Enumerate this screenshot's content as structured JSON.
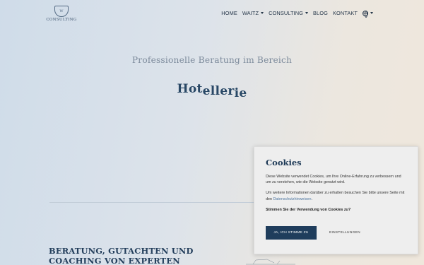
{
  "logo": {
    "crest_text": "W",
    "small_text": "WAITZ",
    "brand_text": "CONSULTING"
  },
  "nav": {
    "items": [
      {
        "label": "HOME"
      },
      {
        "label": "WAITZ"
      },
      {
        "label": "CONSULTING"
      },
      {
        "label": "BLOG"
      },
      {
        "label": "KONTAKT"
      }
    ]
  },
  "hero": {
    "subtitle": "Professionelle Beratung im Bereich",
    "word_parts": [
      "Hot",
      "eller",
      "ie"
    ]
  },
  "section": {
    "title": "Beratung, Gutachten und Coaching von Experten"
  },
  "cookie": {
    "title": "Cookies",
    "text1": "Diese Website verwendet Cookies, um Ihre Online-Erfahrung zu verbessern und um zu verstehen, wie die Website genutzt wird.",
    "text2_prefix": "Um weitere Informationen darüber zu erhalten besuchen Sie bitte unsere Seite mit den ",
    "text2_link": "Datenschutzhinweisen",
    "text2_suffix": ".",
    "question": "Stimmen Sie der Verwendung von Cookies zu?",
    "accept_label": "JA, ICH STIMME ZU",
    "settings_label": "EINSTELLUNGEN"
  }
}
